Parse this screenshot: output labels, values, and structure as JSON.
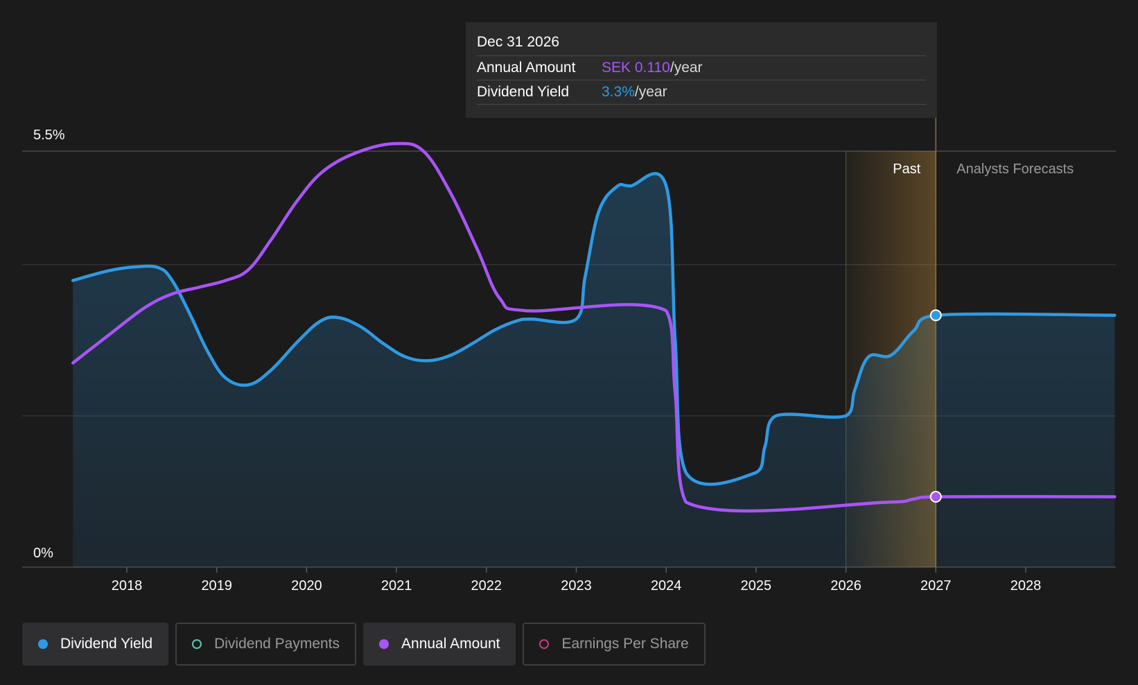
{
  "tooltip": {
    "date": "Dec 31 2026",
    "annual_amount_label": "Annual Amount",
    "annual_amount_value": "SEK 0.110",
    "dividend_yield_label": "Dividend Yield",
    "dividend_yield_value": "3.3%",
    "unit": "/year"
  },
  "sections": {
    "past_label": "Past",
    "forecast_label": "Analysts Forecasts"
  },
  "legend": [
    {
      "label": "Dividend Yield",
      "color": "#2f9ae3",
      "active": true,
      "filled": true
    },
    {
      "label": "Dividend Payments",
      "color": "#59c9b0",
      "active": false,
      "filled": false
    },
    {
      "label": "Annual Amount",
      "color": "#a855f7",
      "active": true,
      "filled": true
    },
    {
      "label": "Earnings Per Share",
      "color": "#c0417f",
      "active": false,
      "filled": false
    }
  ],
  "chart_data": {
    "type": "area",
    "title": "",
    "xlabel": "",
    "ylabel": "",
    "x_ticks": [
      "2018",
      "2019",
      "2020",
      "2021",
      "2022",
      "2023",
      "2024",
      "2025",
      "2026",
      "2027",
      "2028"
    ],
    "y_tick_labels": [
      "5.5%",
      "0%"
    ],
    "ylim": [
      0,
      5.5
    ],
    "xlim": [
      2017.4,
      2028.99
    ],
    "forecast_start": 2026.0,
    "past_end": 2027.0,
    "grid": true,
    "legend_position": "bottom-left",
    "series": [
      {
        "name": "Dividend Yield",
        "color": "#2f9ae3",
        "fill": true,
        "points": [
          [
            2017.4,
            3.79
          ],
          [
            2017.8,
            3.92
          ],
          [
            2018.1,
            3.97
          ],
          [
            2018.35,
            3.96
          ],
          [
            2018.5,
            3.8
          ],
          [
            2018.7,
            3.35
          ],
          [
            2018.9,
            2.85
          ],
          [
            2019.1,
            2.5
          ],
          [
            2019.35,
            2.41
          ],
          [
            2019.6,
            2.6
          ],
          [
            2019.9,
            2.98
          ],
          [
            2020.15,
            3.25
          ],
          [
            2020.35,
            3.3
          ],
          [
            2020.6,
            3.18
          ],
          [
            2020.85,
            2.96
          ],
          [
            2021.1,
            2.78
          ],
          [
            2021.35,
            2.73
          ],
          [
            2021.6,
            2.8
          ],
          [
            2021.85,
            2.96
          ],
          [
            2022.1,
            3.14
          ],
          [
            2022.35,
            3.26
          ],
          [
            2022.5,
            3.28
          ],
          [
            2023.0,
            3.28
          ],
          [
            2023.1,
            3.85
          ],
          [
            2023.25,
            4.7
          ],
          [
            2023.45,
            5.03
          ],
          [
            2023.6,
            5.04
          ],
          [
            2024.0,
            5.04
          ],
          [
            2024.1,
            3.0
          ],
          [
            2024.22,
            1.25
          ],
          [
            2025.0,
            1.25
          ],
          [
            2025.1,
            1.6
          ],
          [
            2025.22,
            2.0
          ],
          [
            2026.0,
            2.0
          ],
          [
            2026.1,
            2.35
          ],
          [
            2026.25,
            2.78
          ],
          [
            2026.5,
            2.8
          ],
          [
            2026.75,
            3.12
          ],
          [
            2027.0,
            3.33
          ],
          [
            2028.99,
            3.33
          ]
        ]
      },
      {
        "name": "Annual Amount",
        "color": "#a855f7",
        "fill": false,
        "points": [
          [
            2017.4,
            2.7
          ],
          [
            2017.8,
            3.07
          ],
          [
            2018.2,
            3.43
          ],
          [
            2018.5,
            3.61
          ],
          [
            2018.8,
            3.7
          ],
          [
            2019.1,
            3.79
          ],
          [
            2019.35,
            3.93
          ],
          [
            2019.6,
            4.32
          ],
          [
            2019.9,
            4.85
          ],
          [
            2020.2,
            5.25
          ],
          [
            2020.6,
            5.5
          ],
          [
            2021.0,
            5.6
          ],
          [
            2021.3,
            5.5
          ],
          [
            2021.6,
            4.95
          ],
          [
            2021.9,
            4.2
          ],
          [
            2022.15,
            3.55
          ],
          [
            2022.45,
            3.39
          ],
          [
            2024.0,
            3.39
          ],
          [
            2024.1,
            2.3
          ],
          [
            2024.22,
            0.86
          ],
          [
            2026.5,
            0.86
          ],
          [
            2026.75,
            0.9
          ],
          [
            2027.0,
            0.93
          ],
          [
            2028.99,
            0.93
          ]
        ]
      }
    ],
    "highlight": {
      "x": 2027.0,
      "dividend_yield": 3.3,
      "annual_amount": 0.11
    }
  }
}
